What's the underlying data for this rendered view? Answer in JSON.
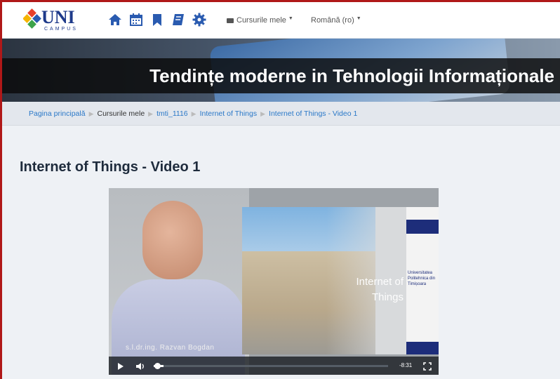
{
  "header": {
    "logo_text": "UNI",
    "logo_sub": "CAMPUS",
    "nav_icons": [
      "home-icon",
      "calendar-icon",
      "bookmark-icon",
      "book-icon",
      "gear-icon"
    ],
    "menu_courses": "Cursurile mele",
    "menu_language": "Română (ro)"
  },
  "banner": {
    "title": "Tendințe moderne in Tehnologii Informaționale"
  },
  "breadcrumb": {
    "items": [
      "Pagina principală",
      "Cursurile mele",
      "tmti_1116",
      "Internet of Things",
      "Internet of Things - Video 1"
    ]
  },
  "page": {
    "title": "Internet of Things - Video 1"
  },
  "video": {
    "caption": "s.l.dr.ing. Razvan Bogdan",
    "slide_line1": "Internet of",
    "slide_line2": "Things",
    "slide_side": "Universitatea Politehnica din Timișoara",
    "time_remaining": "-8:31",
    "progress": 0.0,
    "volume": 0.3
  },
  "colors": {
    "accent_link": "#2a78c8",
    "nav_icon": "#2a5bb0",
    "frame_border": "#b01818"
  }
}
